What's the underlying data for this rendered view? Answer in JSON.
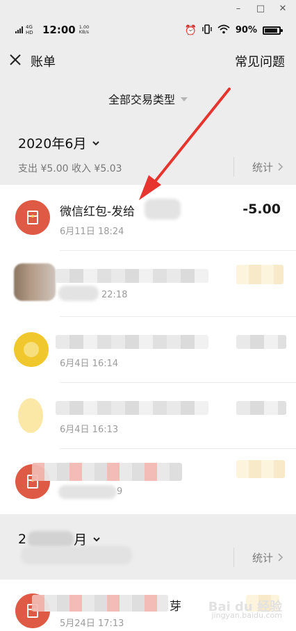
{
  "window": {
    "minimize": "–",
    "maximize": "□",
    "close": "✕"
  },
  "status_bar": {
    "network_type": "4G HD",
    "time": "12:00",
    "speed_value": "1.00",
    "speed_unit": "KB/s",
    "battery": "90%",
    "icons": [
      "alarm-icon",
      "vibrate-icon",
      "wifi-icon",
      "battery-icon"
    ]
  },
  "nav": {
    "title": "账单",
    "right_action": "常见问题",
    "close_icon": "close-icon"
  },
  "filter": {
    "label": "全部交易类型",
    "caret": "caret-down-icon"
  },
  "months": [
    {
      "title": "2020年6月",
      "summary": "支出 ¥5.00 收入 ¥5.03",
      "stat_label": "统计",
      "items": [
        {
          "icon": "red-packet-icon",
          "title": "微信红包-发给",
          "time": "6月11日 18:24",
          "amount": "-5.00"
        },
        {
          "icon": "blurred-avatar",
          "title": "",
          "time": "22:18",
          "amount": ""
        },
        {
          "icon": "coin-icon",
          "title": "",
          "time": "6月4日 16:14",
          "amount": ""
        },
        {
          "icon": "pale-icon",
          "title": "",
          "time": "6月4日 16:13",
          "amount": ""
        },
        {
          "icon": "red-packet-icon",
          "title": "",
          "time": "9",
          "amount": ""
        }
      ]
    },
    {
      "title": "2",
      "month_suffix": "月",
      "summary": "",
      "stat_label": "统计",
      "items": [
        {
          "icon": "red-packet-icon",
          "title": "芽",
          "time": "5月24日 17:13",
          "amount": ""
        }
      ]
    }
  ],
  "colors": {
    "accent_red": "#de5a44",
    "pointer_arrow": "#e8342f",
    "background": "#ededed"
  },
  "watermark": {
    "line1": "Bai du 经验",
    "line2": "jingyan.baidu.com"
  }
}
